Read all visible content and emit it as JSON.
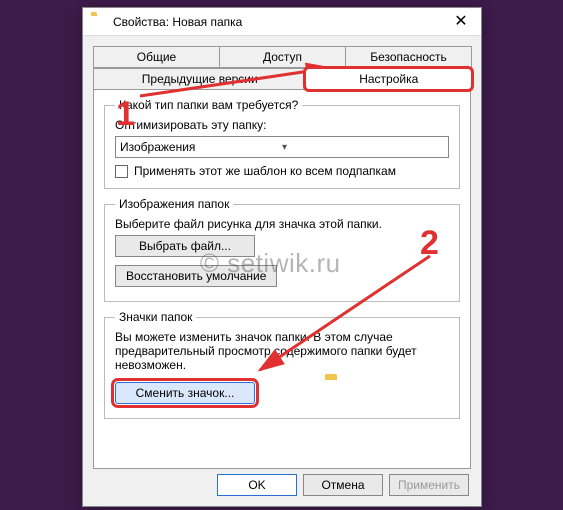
{
  "window": {
    "title": "Свойства: Новая папка",
    "close": "✕"
  },
  "tabs": {
    "row1": [
      "Общие",
      "Доступ",
      "Безопасность"
    ],
    "row2": [
      "Предыдущие версии",
      "Настройка"
    ]
  },
  "group_type": {
    "legend": "Какой тип папки вам требуется?",
    "optimize_label": "Оптимизировать эту папку:",
    "combo_value": "Изображения",
    "checkbox_label": "Применять этот же шаблон ко всем подпапкам"
  },
  "group_images": {
    "legend": "Изображения папок",
    "desc": "Выберите файл рисунка для значка этой папки.",
    "choose_btn": "Выбрать файл...",
    "restore_btn": "Восстановить умолчание"
  },
  "group_icons": {
    "legend": "Значки папок",
    "desc": "Вы можете изменить значок папки. В этом случае предварительный просмотр содержимого папки будет невозможен.",
    "change_btn": "Сменить значок..."
  },
  "buttons": {
    "ok": "OK",
    "cancel": "Отмена",
    "apply": "Применить"
  },
  "watermark": "© setiwik.ru",
  "hints": {
    "one": "1",
    "two": "2"
  }
}
